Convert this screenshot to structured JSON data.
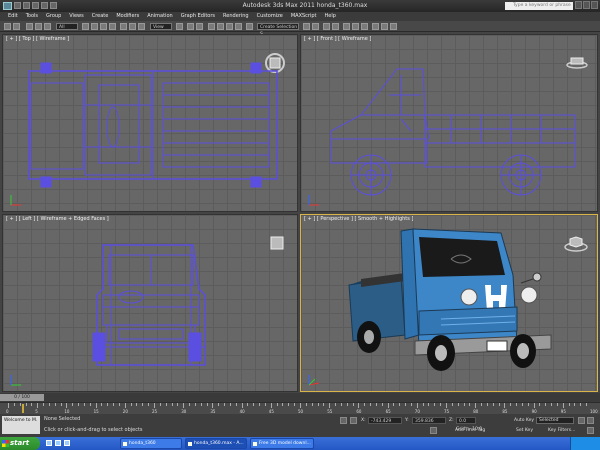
{
  "window": {
    "title": "Autodesk 3ds Max  2011     honda_t360.max",
    "search_placeholder": "Type a keyword or phrase"
  },
  "menu": [
    "Edit",
    "Tools",
    "Group",
    "Views",
    "Create",
    "Modifiers",
    "Animation",
    "Graph Editors",
    "Rendering",
    "Customize",
    "MAXScript",
    "Help"
  ],
  "toolbar": {
    "filter_value": "All",
    "refcoord_value": "View",
    "named_selection_placeholder": "Create Selection S..."
  },
  "viewports": {
    "top": {
      "label": "[ + ] [ Top ] [ Wireframe ]"
    },
    "front": {
      "label": "[ + ] [ Front ] [ Wireframe ]"
    },
    "left": {
      "label": "[ + ] [ Left ] [ Wireframe + Edged Faces ]"
    },
    "perspective": {
      "label": "[ + ] [ Perspective ] [ Smooth + Highlights ]"
    }
  },
  "timeline": {
    "slider_text": "0 / 100",
    "ticks": [
      "0",
      "5",
      "10",
      "15",
      "20",
      "25",
      "30",
      "35",
      "40",
      "45",
      "50",
      "55",
      "60",
      "65",
      "70",
      "75",
      "80",
      "85",
      "90",
      "95",
      "100"
    ]
  },
  "status": {
    "listener": "Welcome to M.",
    "selection": "None Selected",
    "prompt": "Click or click-and-drag to select objects",
    "x_label": "X:",
    "y_label": "Y:",
    "z_label": "Z:",
    "x_value": "-743.429",
    "y_value": "359.836",
    "z_value": "0.0",
    "grid": "Grid = 10.0",
    "add_time_tag": "Add Time Tag",
    "auto_key": "Auto Key",
    "auto_key_value": "Selected",
    "set_key": "Set Key",
    "key_filters": "Key Filters..."
  },
  "taskbar": {
    "start": "start",
    "tasks": [
      "honda_t360",
      "honda_t360.max - A...",
      "Free 3D model downl..."
    ],
    "tray_time": ""
  },
  "colors": {
    "wireframe": "#5a4fe0",
    "active_border": "#d9b44a",
    "truck_body": "#3d87c9",
    "truck_bed": "#2b5d86"
  }
}
